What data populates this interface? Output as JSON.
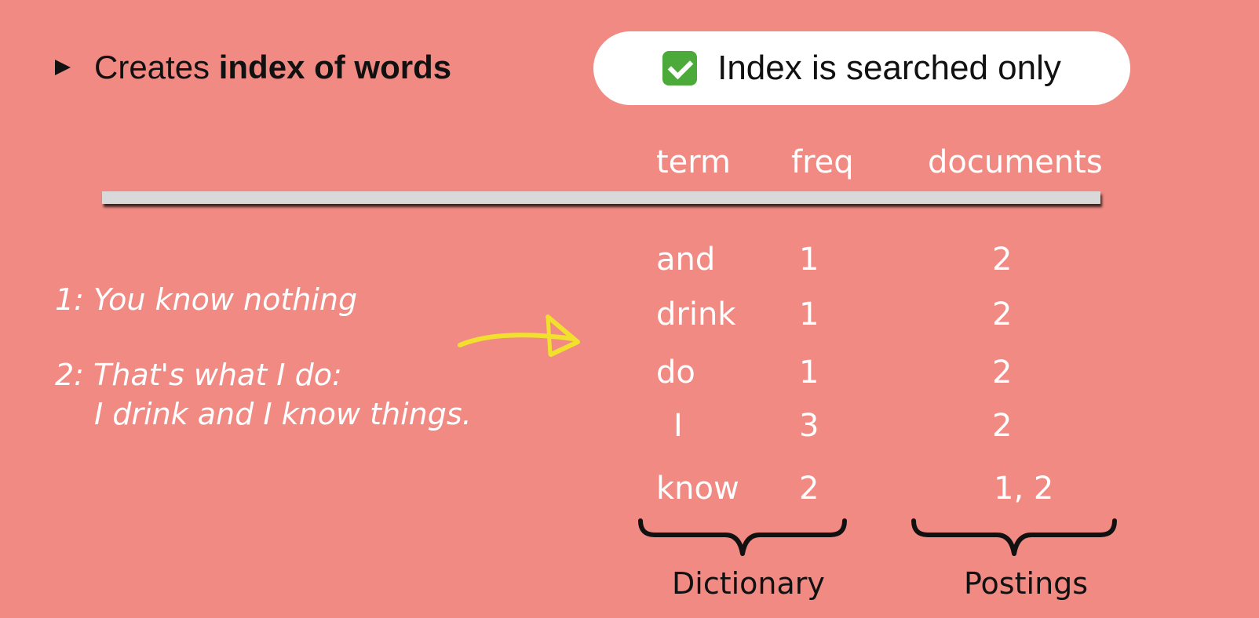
{
  "bullet": {
    "text_plain": "Creates ",
    "text_bold": "index of words"
  },
  "pill": {
    "text": "Index is searched only"
  },
  "table": {
    "headers": {
      "term": "term",
      "freq": "freq",
      "documents": "documents"
    },
    "rows": [
      {
        "term": "and",
        "freq": "1",
        "documents": "2"
      },
      {
        "term": "drink",
        "freq": "1",
        "documents": "2"
      },
      {
        "term": "do",
        "freq": "1",
        "documents": "2"
      },
      {
        "term": "I",
        "freq": "3",
        "documents": "2"
      },
      {
        "term": "know",
        "freq": "2",
        "documents": "1, 2"
      }
    ]
  },
  "documents_text": {
    "doc1": "1: You know nothing",
    "doc2_line1": "2: That's what I do:",
    "doc2_line2": "I drink and I know things."
  },
  "labels": {
    "dictionary": "Dictionary",
    "postings": "Postings"
  },
  "colors": {
    "background": "#f08a83",
    "arrow": "#f2e02e",
    "check": "#4caa3b"
  }
}
